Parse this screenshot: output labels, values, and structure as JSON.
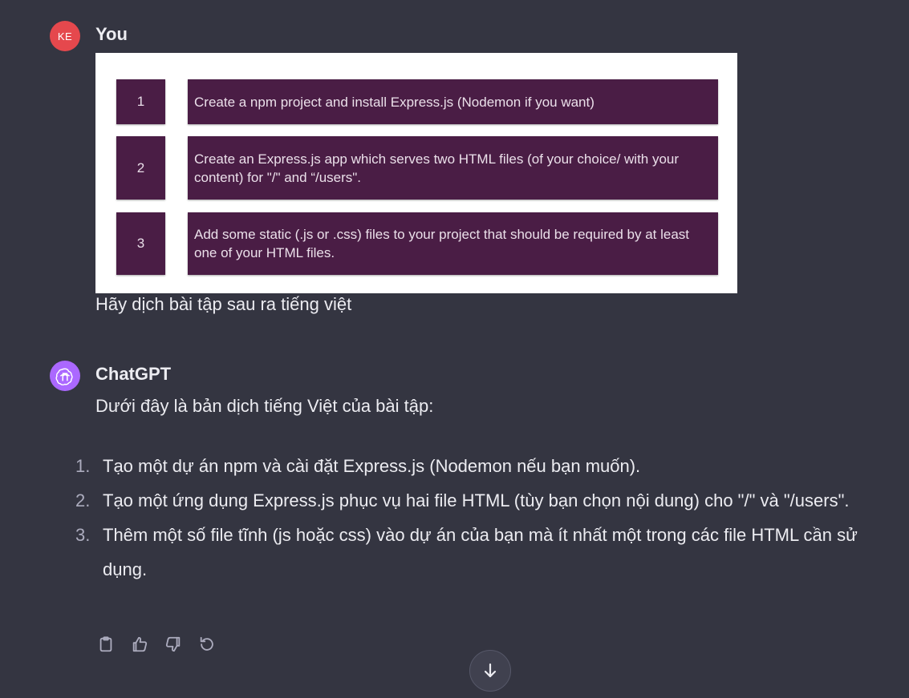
{
  "user_message": {
    "avatar_initials": "KE",
    "author": "You",
    "image_tasks": [
      {
        "number": "1",
        "text": "Create a npm project and install Express.js (Nodemon if you want)"
      },
      {
        "number": "2",
        "text": "Create an Express.js app which serves two HTML files (of your choice/ with your content) for \"/\" and “/users\"."
      },
      {
        "number": "3",
        "text": "Add some static (.js or .css) files to your project that should be required by at least one of your HTML files."
      }
    ],
    "prompt": "Hãy dịch bài tập sau ra tiếng việt"
  },
  "assistant_message": {
    "author": "ChatGPT",
    "intro": "Dưới đây là bản dịch tiếng Việt của bài tập:",
    "items": [
      {
        "number": "1.",
        "text": "Tạo một dự án npm và cài đặt Express.js (Nodemon nếu bạn muốn)."
      },
      {
        "number": "2.",
        "text": "Tạo một ứng dụng Express.js phục vụ hai file HTML (tùy bạn chọn nội dung) cho \"/\" và \"/users\"."
      },
      {
        "number": "3.",
        "text": "Thêm một số file tĩnh (js hoặc css) vào dự án của bạn mà ít nhất một trong các file HTML cần sử dụng."
      }
    ]
  },
  "actions": {
    "icons": [
      "clipboard-icon",
      "thumbs-up-icon",
      "thumbs-down-icon",
      "regenerate-icon"
    ]
  },
  "scroll_button": {
    "icon": "arrow-down-icon"
  },
  "colors": {
    "background": "#343541",
    "user_avatar": "#e5484d",
    "gpt_avatar": "#ab68ff",
    "task_box": "#4a1d45"
  }
}
